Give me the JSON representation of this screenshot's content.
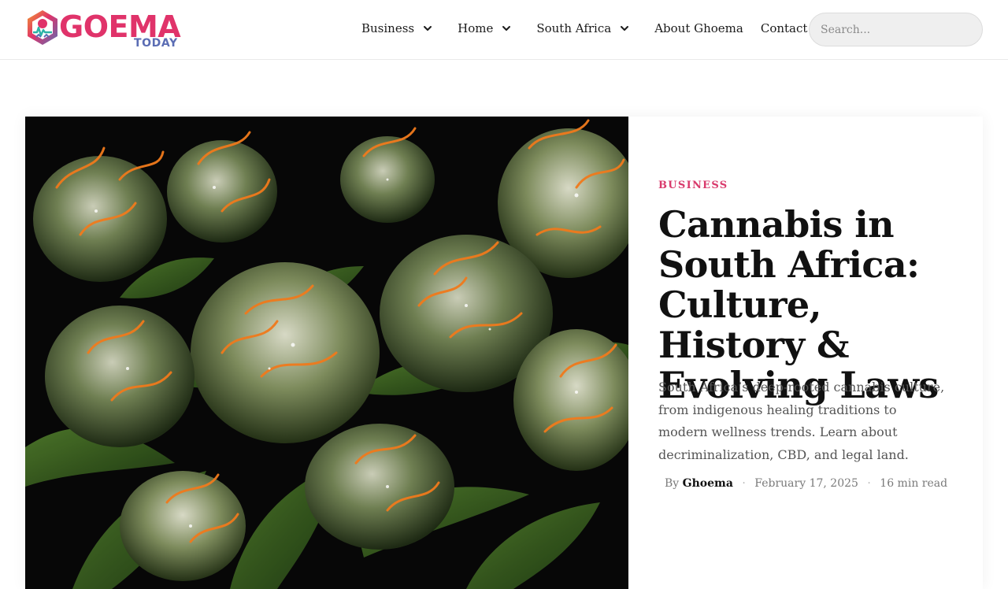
{
  "site": {
    "logo_text": "GOEMA",
    "logo_subtext": "TODAY",
    "brand_colors": {
      "pink": "#e0336a",
      "blue": "#5b6db4",
      "orange": "#f29a2e",
      "teal": "#2bb3a6"
    }
  },
  "nav": {
    "items": [
      {
        "label": "Business",
        "has_dropdown": true
      },
      {
        "label": "Home",
        "has_dropdown": true
      },
      {
        "label": "South Africa",
        "has_dropdown": true
      },
      {
        "label": "About Ghoema",
        "has_dropdown": false
      },
      {
        "label": "Contact",
        "has_dropdown": false
      }
    ],
    "dropdown_icon": "chevron-down-icon"
  },
  "search": {
    "placeholder": "Search...",
    "value": ""
  },
  "featured": {
    "image_subject": "cannabis-buds-photo",
    "category": "BUSINESS",
    "title": "Cannabis in South Africa: Culture, History & Evolving Laws",
    "excerpt": "South Africa’s deep-rooted cannabis culture, from indigenous healing traditions to modern wellness trends. Learn about decriminalization, CBD, and legal land.",
    "by_label": "By",
    "author": "Ghoema",
    "date": "February 17, 2025",
    "read_time": "16 min read"
  }
}
